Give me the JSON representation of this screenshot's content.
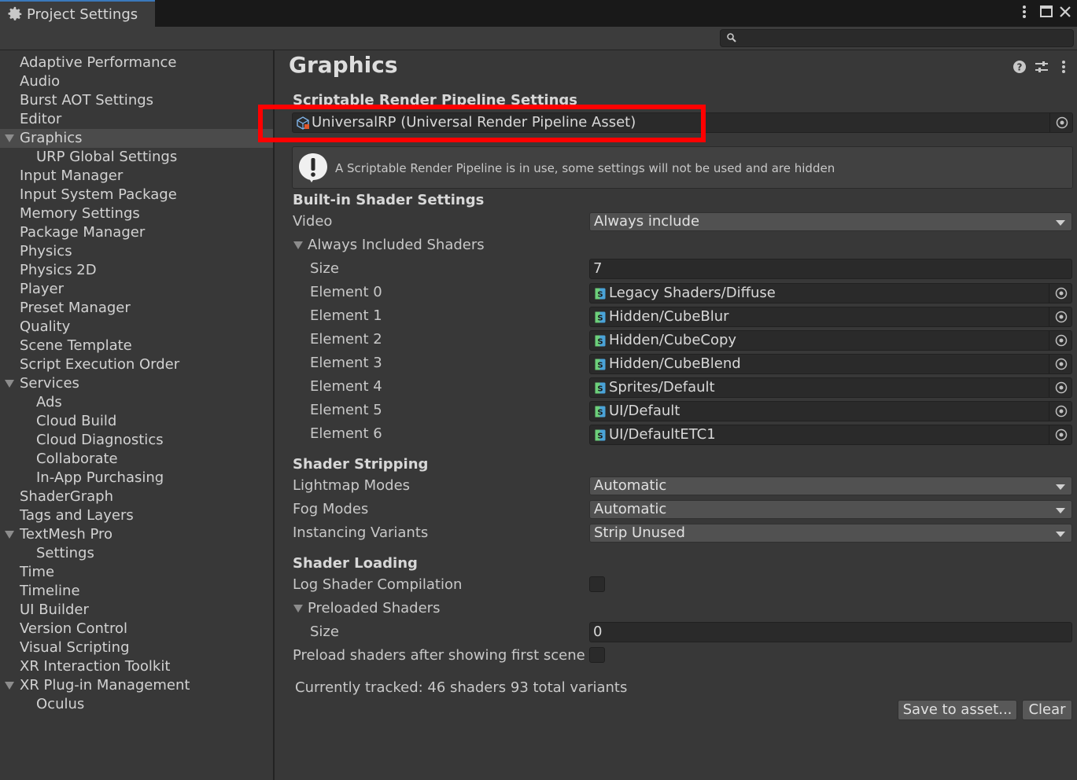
{
  "window": {
    "tab_title": "Project Settings",
    "more_icon": "kebab-menu-icon",
    "maximize_icon": "maximize-icon",
    "close_icon": "close-icon"
  },
  "search": {
    "placeholder": "",
    "icon": "search-icon"
  },
  "sidebar": {
    "items": [
      {
        "label": "Adaptive Performance"
      },
      {
        "label": "Audio"
      },
      {
        "label": "Burst AOT Settings"
      },
      {
        "label": "Editor"
      },
      {
        "label": "Graphics",
        "selected": true,
        "expanded": true
      },
      {
        "label": "URP Global Settings"
      },
      {
        "label": "Input Manager"
      },
      {
        "label": "Input System Package"
      },
      {
        "label": "Memory Settings"
      },
      {
        "label": "Package Manager"
      },
      {
        "label": "Physics"
      },
      {
        "label": "Physics 2D"
      },
      {
        "label": "Player"
      },
      {
        "label": "Preset Manager"
      },
      {
        "label": "Quality"
      },
      {
        "label": "Scene Template"
      },
      {
        "label": "Script Execution Order"
      },
      {
        "label": "Services",
        "expanded": true
      },
      {
        "label": "Ads"
      },
      {
        "label": "Cloud Build"
      },
      {
        "label": "Cloud Diagnostics"
      },
      {
        "label": "Collaborate"
      },
      {
        "label": "In-App Purchasing"
      },
      {
        "label": "ShaderGraph"
      },
      {
        "label": "Tags and Layers"
      },
      {
        "label": "TextMesh Pro",
        "expanded": true
      },
      {
        "label": "Settings"
      },
      {
        "label": "Time"
      },
      {
        "label": "Timeline"
      },
      {
        "label": "UI Builder"
      },
      {
        "label": "Version Control"
      },
      {
        "label": "Visual Scripting"
      },
      {
        "label": "XR Interaction Toolkit"
      },
      {
        "label": "XR Plug-in Management",
        "expanded": true
      },
      {
        "label": "Oculus"
      }
    ]
  },
  "main": {
    "title": "Graphics",
    "header_icons": [
      "help-icon",
      "presets-icon",
      "kebab-menu-icon"
    ],
    "srp": {
      "header": "Scriptable Render Pipeline Settings",
      "asset": "UniversalRP (Universal Render Pipeline Asset)",
      "help_text": "A Scriptable Render Pipeline is in use, some settings will not be used and are hidden"
    },
    "builtin": {
      "header": "Built-in Shader Settings",
      "video_label": "Video",
      "video_value": "Always include",
      "always_included_label": "Always Included Shaders",
      "size_label": "Size",
      "size_value": "7",
      "elements": [
        {
          "label": "Element 0",
          "value": "Legacy Shaders/Diffuse"
        },
        {
          "label": "Element 1",
          "value": "Hidden/CubeBlur"
        },
        {
          "label": "Element 2",
          "value": "Hidden/CubeCopy"
        },
        {
          "label": "Element 3",
          "value": "Hidden/CubeBlend"
        },
        {
          "label": "Element 4",
          "value": "Sprites/Default"
        },
        {
          "label": "Element 5",
          "value": "UI/Default"
        },
        {
          "label": "Element 6",
          "value": "UI/DefaultETC1"
        }
      ]
    },
    "stripping": {
      "header": "Shader Stripping",
      "lightmap_label": "Lightmap Modes",
      "lightmap_value": "Automatic",
      "fog_label": "Fog Modes",
      "fog_value": "Automatic",
      "instancing_label": "Instancing Variants",
      "instancing_value": "Strip Unused"
    },
    "loading": {
      "header": "Shader Loading",
      "log_label": "Log Shader Compilation",
      "log_checked": false,
      "preloaded_label": "Preloaded Shaders",
      "preloaded_size_label": "Size",
      "preloaded_size_value": "0",
      "preload_after_label": "Preload shaders after showing first scene",
      "preload_after_checked": false
    },
    "tracked_text": "Currently tracked: 46 shaders 93 total variants",
    "save_button": "Save to asset...",
    "clear_button": "Clear"
  },
  "colors": {
    "highlight": "#ff0000",
    "tab_accent": "#3a79bb",
    "selected_row": "#4b4b4b"
  }
}
